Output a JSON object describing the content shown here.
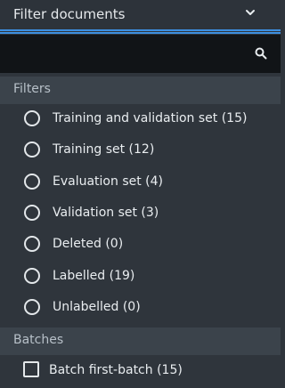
{
  "dropdown": {
    "label": "Filter documents"
  },
  "search": {
    "placeholder": ""
  },
  "filters": {
    "header": "Filters",
    "items": [
      {
        "label": "Training and validation set (15)"
      },
      {
        "label": "Training set (12)"
      },
      {
        "label": "Evaluation set (4)"
      },
      {
        "label": "Validation set (3)"
      },
      {
        "label": "Deleted (0)"
      },
      {
        "label": "Labelled (19)"
      },
      {
        "label": "Unlabelled (0)"
      }
    ]
  },
  "batches": {
    "header": "Batches",
    "items": [
      {
        "label": "Batch first-batch (15)"
      }
    ]
  },
  "colors": {
    "accent": "#3d8fe0",
    "background": "#2f353c",
    "search_bg": "#111417",
    "section_header_bg": "#3b434b"
  },
  "icons": {
    "dropdown": "chevron-down-icon",
    "search": "search-icon"
  }
}
